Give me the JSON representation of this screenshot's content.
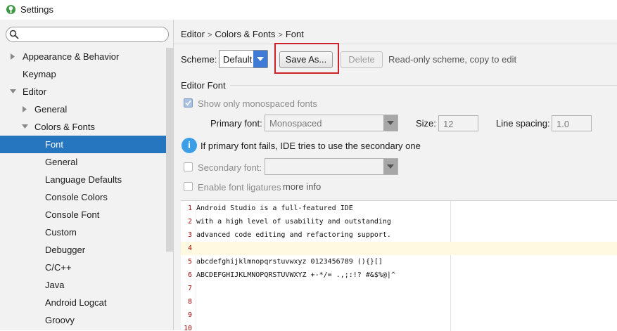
{
  "window": {
    "title": "Settings"
  },
  "search": {
    "placeholder": ""
  },
  "sidebar": {
    "items": [
      {
        "label": "Appearance & Behavior",
        "indent": 0,
        "arrow": "collapsed"
      },
      {
        "label": "Keymap",
        "indent": 0,
        "arrow": "none"
      },
      {
        "label": "Editor",
        "indent": 0,
        "arrow": "expanded"
      },
      {
        "label": "General",
        "indent": 1,
        "arrow": "collapsed"
      },
      {
        "label": "Colors & Fonts",
        "indent": 1,
        "arrow": "expanded"
      },
      {
        "label": "Font",
        "indent": 2,
        "arrow": "none",
        "selected": true
      },
      {
        "label": "General",
        "indent": 2,
        "arrow": "none"
      },
      {
        "label": "Language Defaults",
        "indent": 2,
        "arrow": "none"
      },
      {
        "label": "Console Colors",
        "indent": 2,
        "arrow": "none"
      },
      {
        "label": "Console Font",
        "indent": 2,
        "arrow": "none"
      },
      {
        "label": "Custom",
        "indent": 2,
        "arrow": "none"
      },
      {
        "label": "Debugger",
        "indent": 2,
        "arrow": "none"
      },
      {
        "label": "C/C++",
        "indent": 2,
        "arrow": "none"
      },
      {
        "label": "Java",
        "indent": 2,
        "arrow": "none"
      },
      {
        "label": "Android Logcat",
        "indent": 2,
        "arrow": "none"
      },
      {
        "label": "Groovy",
        "indent": 2,
        "arrow": "none"
      }
    ]
  },
  "breadcrumb": {
    "part1": "Editor",
    "part2": "Colors & Fonts",
    "part3": "Font",
    "separator": ">"
  },
  "scheme": {
    "label": "Scheme:",
    "value": "Default",
    "save_as": "Save As...",
    "delete": "Delete",
    "hint": "Read-only scheme, copy to edit"
  },
  "editor_font": {
    "section_title": "Editor Font",
    "show_monospaced": "Show only monospaced fonts",
    "show_monospaced_checked": true,
    "primary_font_label": "Primary font:",
    "primary_font_value": "Monospaced",
    "size_label": "Size:",
    "size_value": "12",
    "line_spacing_label": "Line spacing:",
    "line_spacing_value": "1.0",
    "info_text": "If primary font fails, IDE tries to use the secondary one",
    "secondary_font_label": "Secondary font:",
    "secondary_font_value": "",
    "secondary_checked": false,
    "ligatures_label": "Enable font ligatures",
    "ligatures_checked": false,
    "more_info": "more info"
  },
  "preview": {
    "current_line": 4,
    "lines": [
      {
        "n": "1",
        "text": "Android Studio is a full-featured IDE"
      },
      {
        "n": "2",
        "text": "with a high level of usability and outstanding"
      },
      {
        "n": "3",
        "text": "advanced code editing and refactoring support."
      },
      {
        "n": "4",
        "text": ""
      },
      {
        "n": "5",
        "text": "abcdefghijklmnopqrstuvwxyz 0123456789 (){}[]"
      },
      {
        "n": "6",
        "text": "ABCDEFGHIJKLMNOPQRSTUVWXYZ +-*/= .,;:!? #&$%@|^"
      },
      {
        "n": "7",
        "text": ""
      },
      {
        "n": "8",
        "text": ""
      },
      {
        "n": "9",
        "text": ""
      },
      {
        "n": "10",
        "text": ""
      }
    ]
  },
  "colors": {
    "selection": "#2675bf",
    "highlight_box": "#cc2128",
    "accent": "#3d7bd7",
    "line_numbers": "#a60d0d",
    "info_icon": "#3b9ee6"
  }
}
